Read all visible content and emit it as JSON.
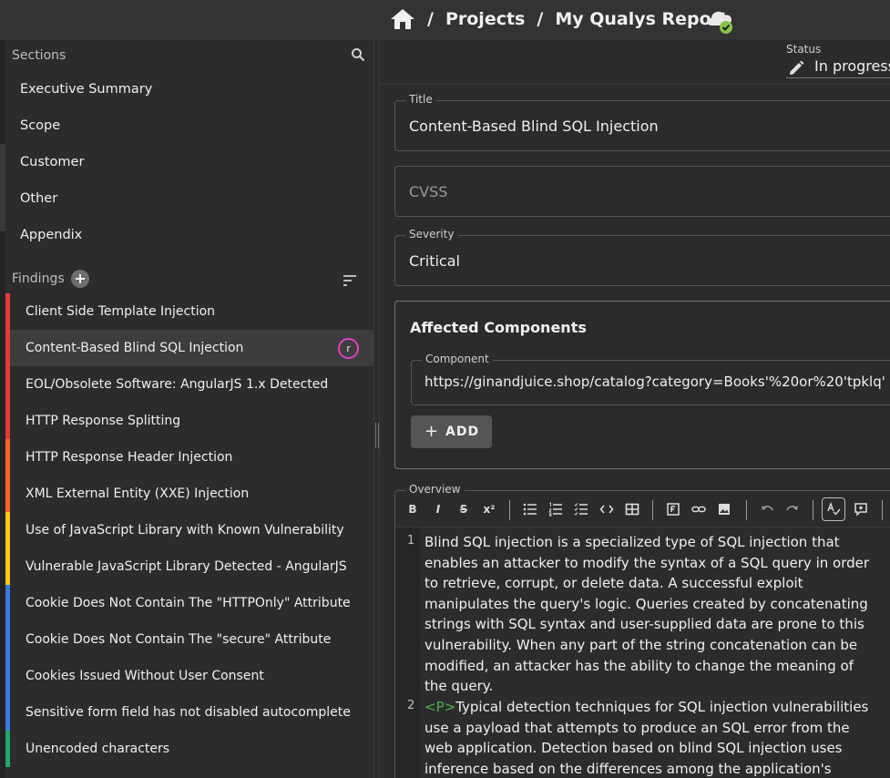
{
  "topbar": {
    "breadcrumb": [
      {
        "label": "Projects"
      },
      {
        "label": "My Qualys Report"
      }
    ],
    "separator": "/"
  },
  "sidebar": {
    "sections_header": "Sections",
    "sections": [
      {
        "label": "Executive Summary"
      },
      {
        "label": "Scope"
      },
      {
        "label": "Customer"
      },
      {
        "label": "Other"
      },
      {
        "label": "Appendix"
      }
    ],
    "findings_header": "Findings",
    "findings": [
      {
        "label": "Client Side Template Injection",
        "severity_color": "#e53935"
      },
      {
        "label": "Content-Based Blind SQL Injection",
        "severity_color": "#e53935",
        "selected": true,
        "assignee": "r"
      },
      {
        "label": "EOL/Obsolete Software: AngularJS 1.x Detected",
        "severity_color": "#e53935"
      },
      {
        "label": "HTTP Response Splitting",
        "severity_color": "#e53935"
      },
      {
        "label": "HTTP Response Header Injection",
        "severity_color": "#f4642a"
      },
      {
        "label": "XML External Entity (XXE) Injection",
        "severity_color": "#f4642a"
      },
      {
        "label": "Use of JavaScript Library with Known Vulnerability",
        "severity_color": "#f5c518"
      },
      {
        "label": "Vulnerable JavaScript Library Detected - AngularJS",
        "severity_color": "#f5c518"
      },
      {
        "label": "Cookie Does Not Contain The \"HTTPOnly\" Attribute",
        "severity_color": "#3b78e7"
      },
      {
        "label": "Cookie Does Not Contain The \"secure\" Attribute",
        "severity_color": "#3b78e7"
      },
      {
        "label": "Cookies Issued Without User Consent",
        "severity_color": "#3b78e7"
      },
      {
        "label": "Sensitive form field has not disabled autocomplete",
        "severity_color": "#3b78e7"
      },
      {
        "label": "Unencoded characters",
        "severity_color": "#1fa96b"
      }
    ]
  },
  "main": {
    "status_label": "Status",
    "status_value": "In progress",
    "title_label": "Title",
    "title_value": "Content-Based Blind SQL Injection",
    "cvss_placeholder": "CVSS",
    "severity_label": "Severity",
    "severity_value": "Critical",
    "affected": {
      "heading": "Affected Components",
      "component_label": "Component",
      "component_value": "https://ginandjuice.shop/catalog?category=Books'%20or%20'tpklq'",
      "add_label": "ADD",
      "add_icon": "+"
    },
    "overview": {
      "label": "Overview",
      "toolbar": {
        "bold": "B",
        "italic": "I",
        "strike": "S",
        "superscript": "x²"
      },
      "lines": [
        {
          "number": "1",
          "text": [
            "Blind SQL injection is a specialized type of SQL injection that",
            "enables an attacker to modify the syntax of a SQL query in order",
            "to retrieve, corrupt, or delete data. A successful exploit",
            "manipulates the query's logic. Queries created by concatenating",
            "strings with SQL syntax and user-supplied data are prone to this",
            "vulnerability. When any part of the string concatenation can be",
            "modified, an attacker has the ability to change the meaning of",
            "the query."
          ]
        },
        {
          "number": "2",
          "tag": "<P>",
          "text": [
            "Typical detection techniques for SQL injection vulnerabilities",
            "use a payload that attempts to produce an SQL error from the",
            "web application. Detection based on blind SQL injection uses",
            "inference based on the differences among the application's"
          ]
        }
      ]
    }
  },
  "colors": {
    "critical": "#e53935",
    "high": "#f4642a",
    "medium": "#f5c518",
    "low": "#3b78e7",
    "info": "#1fa96b",
    "assignee_ring": "#e040c8",
    "sync_ok": "#8bc34a"
  },
  "icons": [
    "home-icon",
    "cloud-sync-icon",
    "search-icon",
    "add-icon",
    "sort-icon",
    "edit-icon",
    "bullet-list-icon",
    "numbered-list-icon",
    "checklist-icon",
    "code-icon",
    "table-icon",
    "footnote-icon",
    "link-icon",
    "image-icon",
    "undo-icon",
    "redo-icon",
    "spellcheck-icon",
    "comment-icon"
  ]
}
